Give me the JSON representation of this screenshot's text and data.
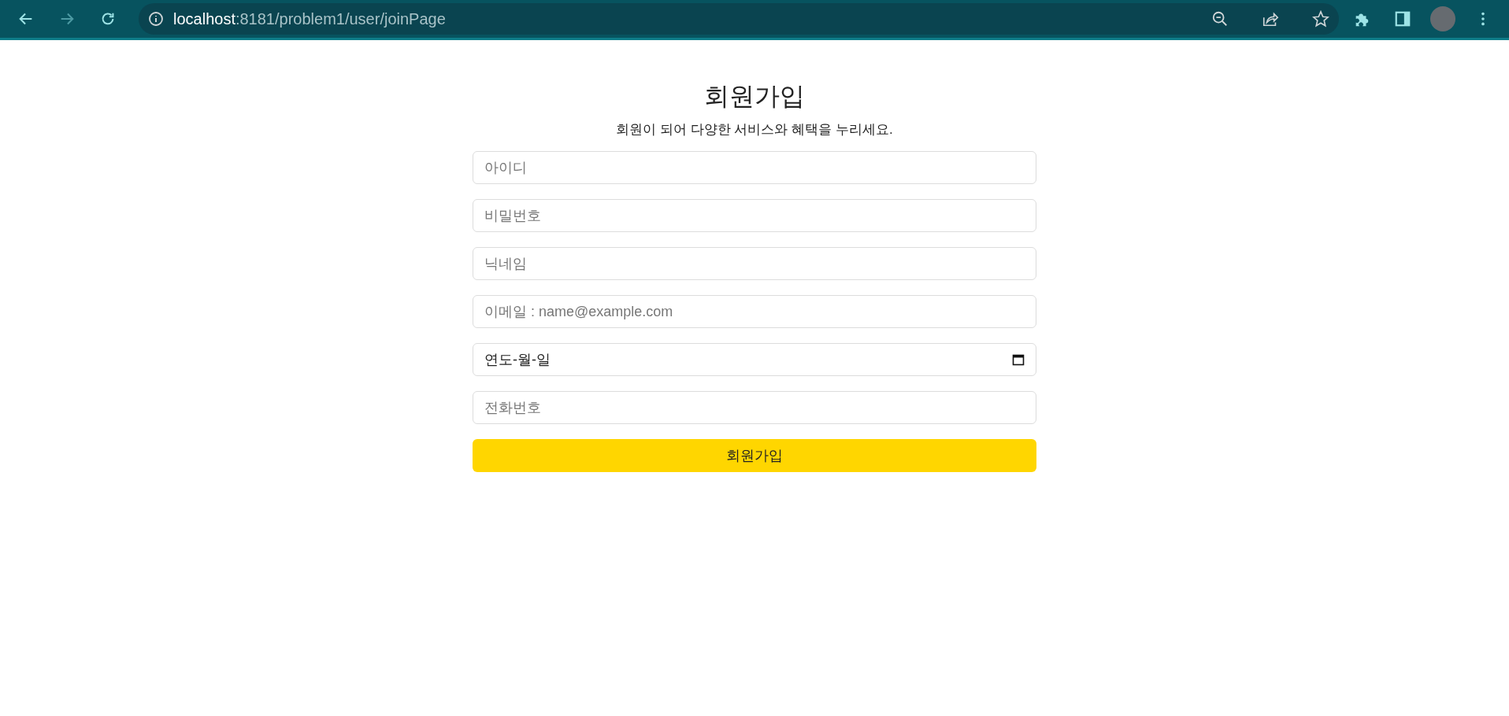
{
  "browser": {
    "address": {
      "host": "localhost",
      "path": ":8181/problem1/user/joinPage"
    }
  },
  "form": {
    "title": "회원가입",
    "subtitle": "회원이 되어 다양한 서비스와 혜택을 누리세요.",
    "fields": [
      {
        "kind": "text",
        "placeholder": "아이디"
      },
      {
        "kind": "text",
        "placeholder": "비밀번호"
      },
      {
        "kind": "text",
        "placeholder": "닉네임"
      },
      {
        "kind": "text",
        "placeholder": "이메일 : name@example.com"
      },
      {
        "kind": "date",
        "value": "연도-월-일"
      },
      {
        "kind": "text",
        "placeholder": "전화번호"
      }
    ],
    "submit": "회원가입"
  }
}
